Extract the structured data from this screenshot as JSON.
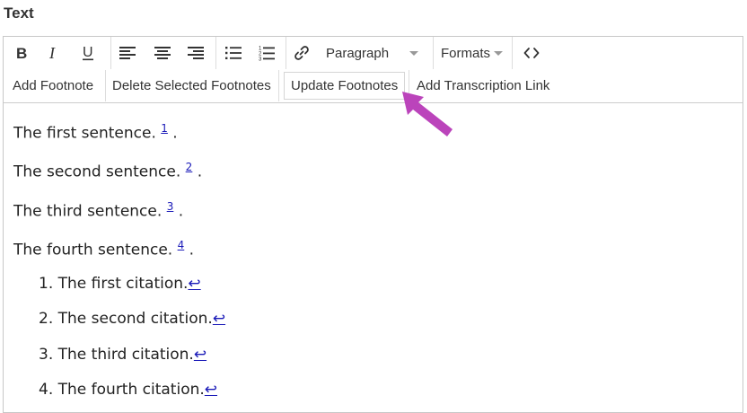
{
  "field": {
    "label": "Text"
  },
  "toolbar": {
    "format_select": "Paragraph",
    "formats_menu": "Formats",
    "footnote_buttons": [
      "Add Footnote",
      "Delete Selected Footnotes",
      "Update Footnotes",
      "Add Transcription Link"
    ],
    "icons": [
      "bold-icon",
      "italic-icon",
      "underline-icon",
      "align-left-icon",
      "align-center-icon",
      "align-right-icon",
      "bullet-list-icon",
      "numbered-list-icon",
      "link-icon",
      "code-view-icon"
    ]
  },
  "content": {
    "paragraphs": [
      {
        "text": "The first sentence.",
        "ref": "1"
      },
      {
        "text": "The second sentence.",
        "ref": "2"
      },
      {
        "text": "The third sentence.",
        "ref": "3"
      },
      {
        "text": "The fourth sentence.",
        "ref": "4"
      }
    ],
    "citations": [
      {
        "num": "1.",
        "text": "The first citation.",
        "back": "↩"
      },
      {
        "num": "2.",
        "text": "The second citation.",
        "back": "↩"
      },
      {
        "num": "3.",
        "text": "The third citation.",
        "back": "↩"
      },
      {
        "num": "4.",
        "text": "The fourth citation.",
        "back": "↩"
      }
    ],
    "paragraph_separator": "."
  },
  "colors": {
    "annotation_arrow": "#bb44bb",
    "link": "#1a1ab8"
  }
}
